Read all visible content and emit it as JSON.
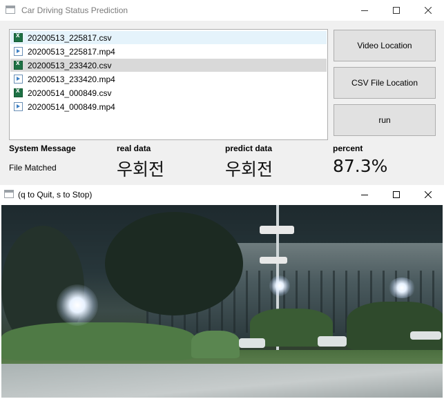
{
  "main_window": {
    "title": "Car Driving Status Prediction",
    "files": [
      {
        "name": "20200513_225817.csv",
        "type": "csv",
        "state": "hover"
      },
      {
        "name": "20200513_225817.mp4",
        "type": "mp4",
        "state": "normal"
      },
      {
        "name": "20200513_233420.csv",
        "type": "csv",
        "state": "selected"
      },
      {
        "name": "20200513_233420.mp4",
        "type": "mp4",
        "state": "normal"
      },
      {
        "name": "20200514_000849.csv",
        "type": "csv",
        "state": "normal"
      },
      {
        "name": "20200514_000849.mp4",
        "type": "mp4",
        "state": "normal"
      }
    ],
    "buttons": {
      "video_location": "Video Location",
      "csv_location": "CSV File Location",
      "run": "run"
    },
    "status": {
      "system_message_label": "System Message",
      "system_message_value": "File Matched",
      "real_data_label": "real data",
      "real_data_value": "우회전",
      "predict_data_label": "predict data",
      "predict_data_value": "우회전",
      "percent_label": "percent",
      "percent_value": "87.3%"
    }
  },
  "video_window": {
    "title": "(q to Quit, s to Stop)"
  },
  "colors": {
    "selected_row": "#d9d9d9",
    "hover_row": "#e5f3fb",
    "button_face": "#e1e1e1",
    "excel_green": "#1e7145"
  }
}
